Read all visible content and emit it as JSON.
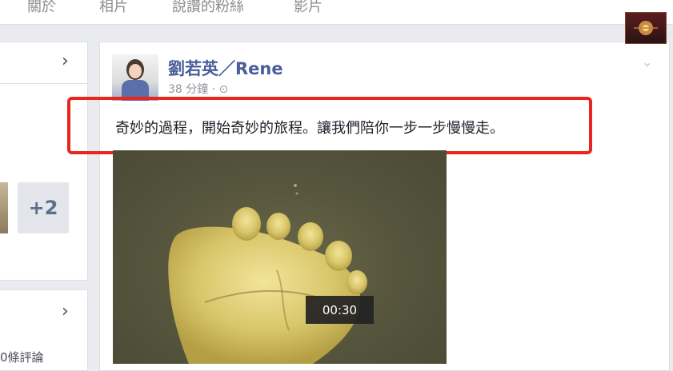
{
  "nav": {
    "tabs": [
      "關於",
      "相片",
      "說讚的粉絲",
      "影片"
    ]
  },
  "left_column": {
    "more_photos_count": "+2",
    "footer_text": "0條評論"
  },
  "post": {
    "author": "劉若英／Rene",
    "timestamp": "38 分鐘 · ⊙",
    "text": "奇妙的過程，開始奇妙的旅程。讓我們陪你一步一步慢慢走。",
    "image_icon": "footprint-image"
  },
  "video": {
    "time": "00:30"
  },
  "colors": {
    "highlight_border": "#e8261f",
    "author_link": "#4a5f99",
    "page_bg": "#e9ebee"
  }
}
